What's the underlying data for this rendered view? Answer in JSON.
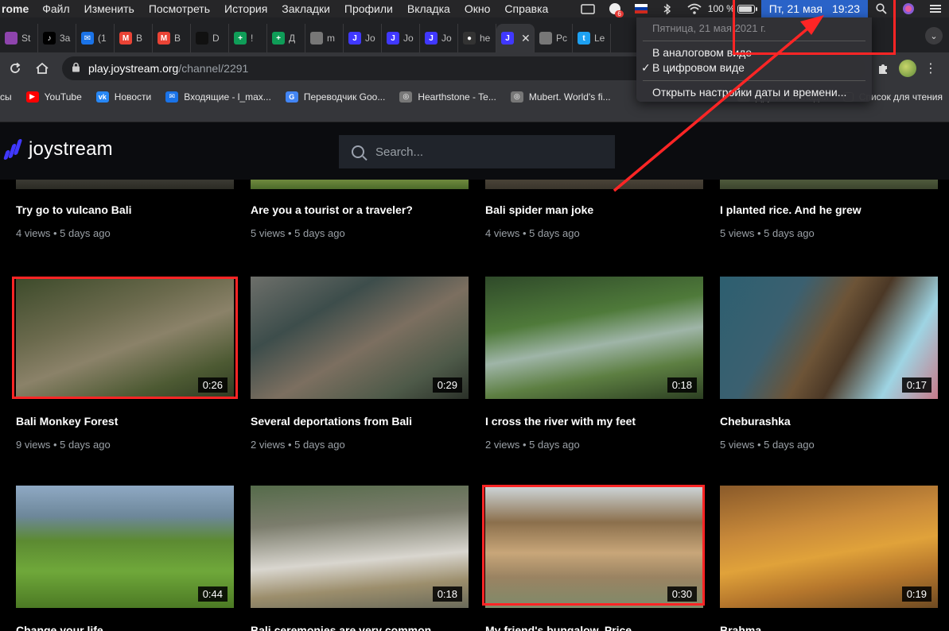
{
  "menubar": {
    "app": "rome",
    "items": [
      "Файл",
      "Изменить",
      "Посмотреть",
      "История",
      "Закладки",
      "Профили",
      "Вкладка",
      "Окно",
      "Справка"
    ],
    "battery": "100 %",
    "clock_date": "Пт, 21 мая",
    "clock_time": "19:23",
    "notif_badge": "6"
  },
  "clock_menu": {
    "date_line": "Пятница, 21 мая 2021 г.",
    "analog": "В аналоговом виде",
    "digital": "В цифровом виде",
    "open_settings": "Открыть настройки даты и времени..."
  },
  "tabs": [
    {
      "label": "St",
      "fav": "",
      "color": "#8e44ad"
    },
    {
      "label": "3a",
      "fav": "♪",
      "color": "#000000"
    },
    {
      "label": "(1",
      "fav": "✉",
      "color": "#1a73e8"
    },
    {
      "label": "B",
      "fav": "M",
      "color": "#ea4335"
    },
    {
      "label": "B",
      "fav": "M",
      "color": "#ea4335"
    },
    {
      "label": "D",
      "fav": "",
      "color": "#111111"
    },
    {
      "label": "!",
      "fav": "+",
      "color": "#0f9d58"
    },
    {
      "label": "Д",
      "fav": "+",
      "color": "#0f9d58"
    },
    {
      "label": "m",
      "fav": "",
      "color": "#777777"
    },
    {
      "label": "Jo",
      "fav": "J",
      "color": "#4038ff"
    },
    {
      "label": "Jo",
      "fav": "J",
      "color": "#4038ff"
    },
    {
      "label": "Jo",
      "fav": "J",
      "color": "#4038ff"
    },
    {
      "label": "he",
      "fav": "●",
      "color": "#333333"
    },
    {
      "label": "",
      "fav": "J",
      "color": "#4038ff"
    },
    {
      "label": "Pc",
      "fav": "",
      "color": "#777777"
    },
    {
      "label": "Le",
      "fav": "t",
      "color": "#1da1f2"
    }
  ],
  "address": {
    "host": "play.joystream.org",
    "path": "/channel/2291"
  },
  "bookmarks": {
    "items": [
      {
        "label": "сы",
        "ico": "",
        "color": "transparent"
      },
      {
        "label": "YouTube",
        "ico": "▶",
        "color": "#ff0000"
      },
      {
        "label": "Новости",
        "ico": "vk",
        "color": "#2787f5"
      },
      {
        "label": "Входящие - l_max...",
        "ico": "✉",
        "color": "#1a73e8"
      },
      {
        "label": "Переводчик Goo...",
        "ico": "G",
        "color": "#4285f4"
      },
      {
        "label": "Hearthstone - Te...",
        "ico": "◎",
        "color": "#777777"
      },
      {
        "label": "Mubert. World's fi...",
        "ico": "◎",
        "color": "#777777"
      }
    ],
    "overflow": "»",
    "other": "Другие закладки",
    "reading_list": "Список для чтения"
  },
  "site": {
    "logo": "joystream",
    "search_placeholder": "Search..."
  },
  "videos": [
    {
      "title": "Try go to vulcano Bali",
      "meta": "4 views • 5 days ago",
      "duration": ""
    },
    {
      "title": "Are you a tourist or a traveler?",
      "meta": "5 views • 5 days ago",
      "duration": ""
    },
    {
      "title": "Bali spider man joke",
      "meta": "4 views • 5 days ago",
      "duration": ""
    },
    {
      "title": "I planted rice. And he grew",
      "meta": "5 views • 5 days ago",
      "duration": ""
    },
    {
      "title": "Bali Monkey Forest",
      "meta": "9 views • 5 days ago",
      "duration": "0:26"
    },
    {
      "title": "Several deportations from Bali",
      "meta": "2 views • 5 days ago",
      "duration": "0:29"
    },
    {
      "title": "I cross the river with my feet",
      "meta": "2 views • 5 days ago",
      "duration": "0:18"
    },
    {
      "title": "Cheburashka",
      "meta": "5 views • 5 days ago",
      "duration": "0:17"
    },
    {
      "title": "Change your life",
      "meta": "",
      "duration": "0:44"
    },
    {
      "title": "Bali ceremonies are very common",
      "meta": "",
      "duration": "0:18"
    },
    {
      "title": "My friend's bungalow. Price",
      "meta": "",
      "duration": "0:30"
    },
    {
      "title": "Brahma",
      "meta": "",
      "duration": "0:19"
    }
  ]
}
